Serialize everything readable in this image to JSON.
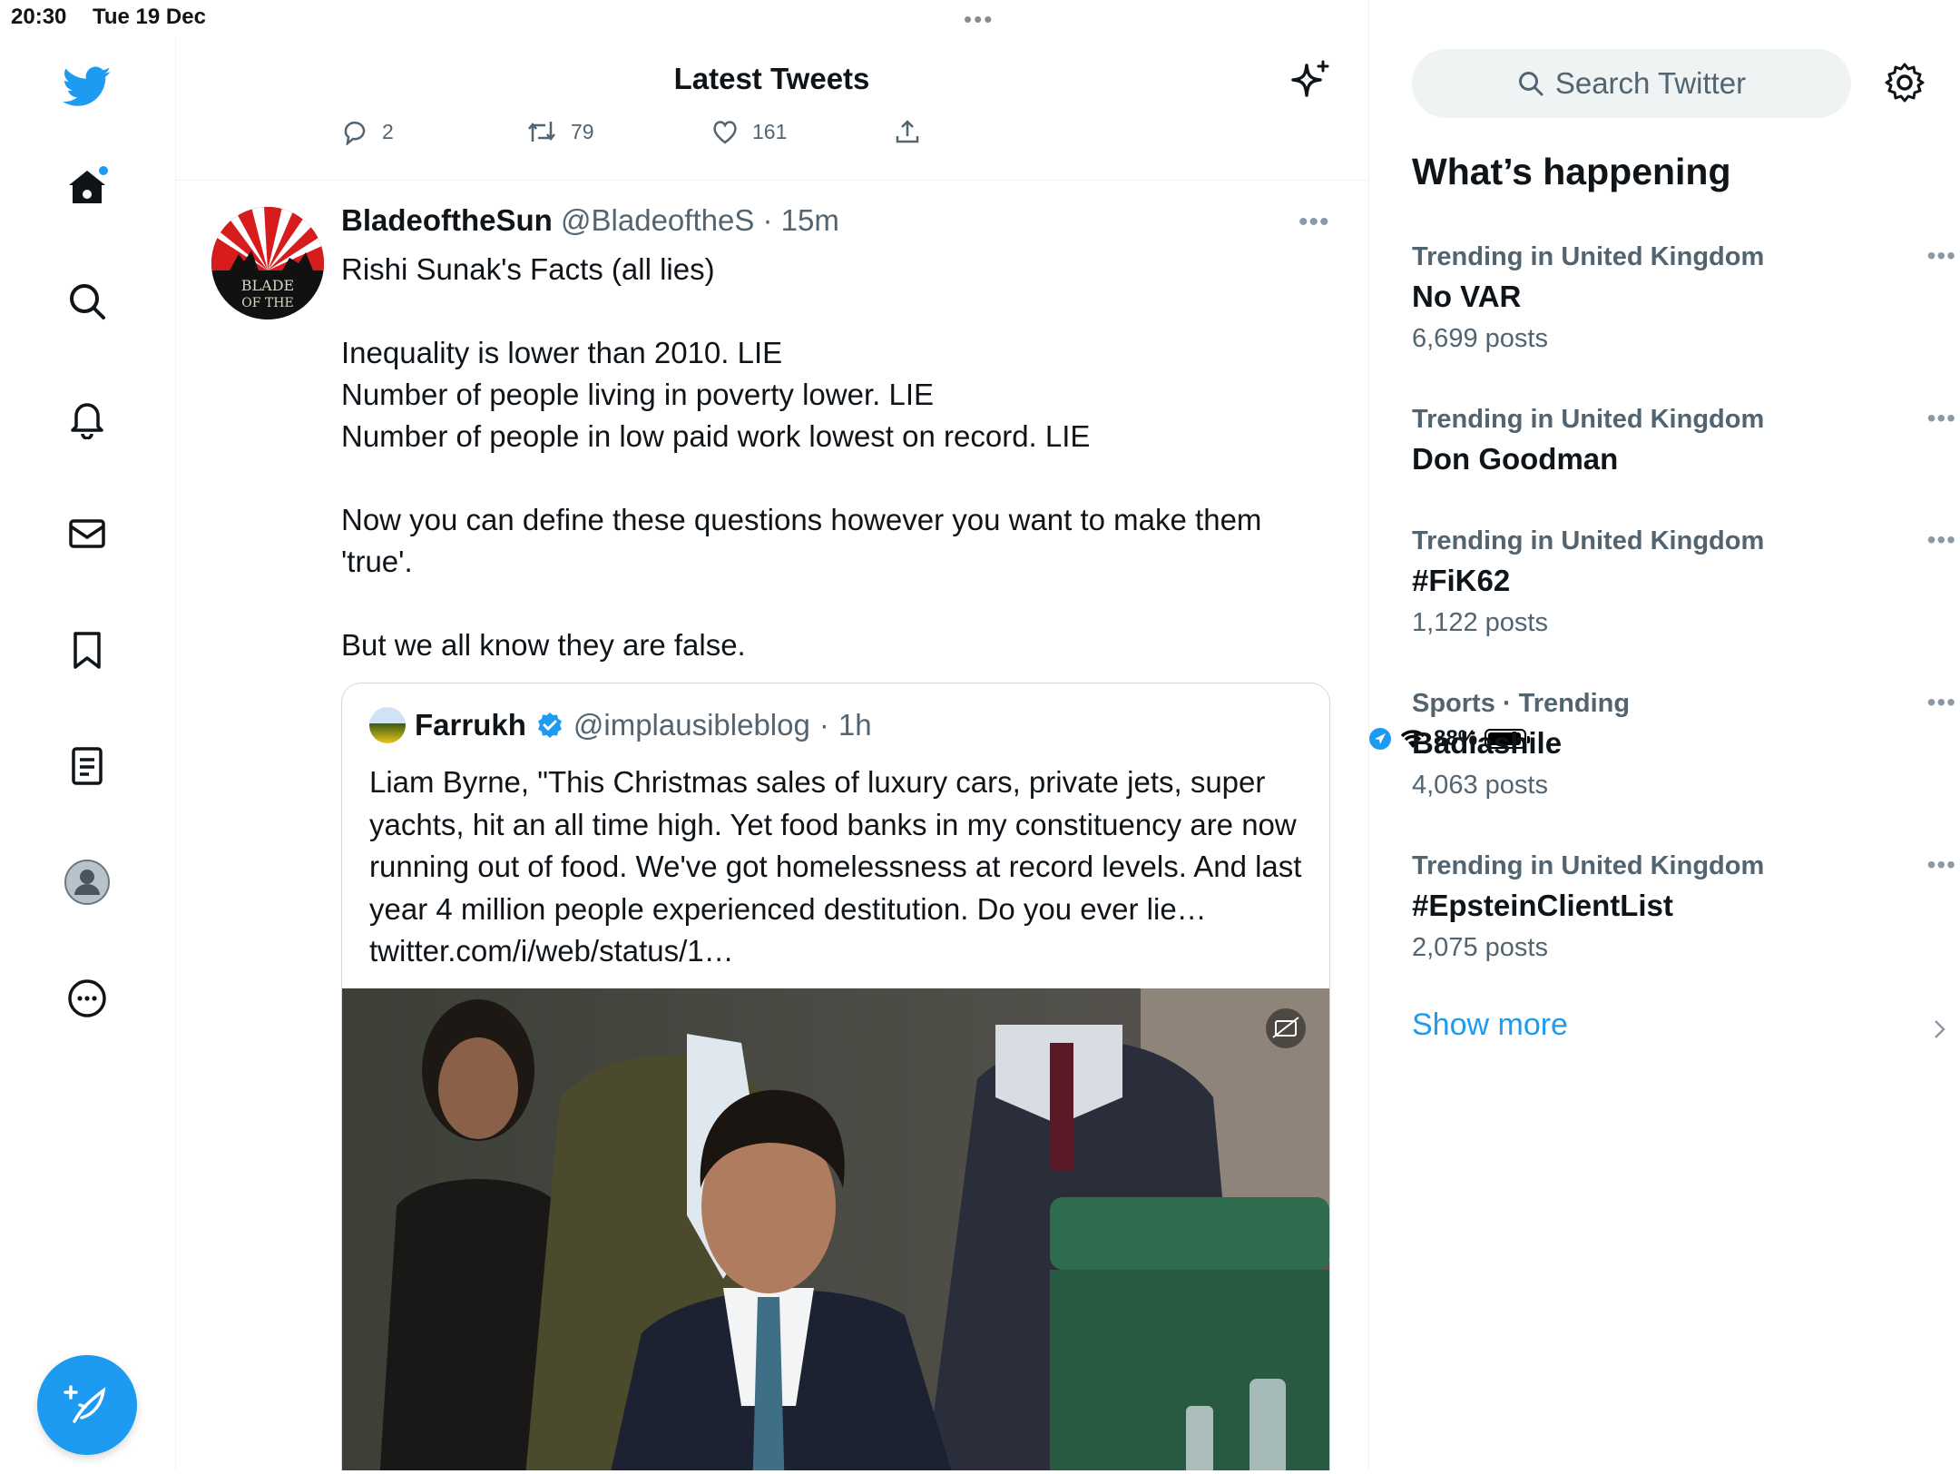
{
  "status_bar": {
    "time": "20:30",
    "date": "Tue 19 Dec",
    "battery": "88%"
  },
  "nav": {
    "items": [
      "twitter-logo",
      "home-icon",
      "search-icon",
      "bell-icon",
      "mail-icon",
      "bookmark-icon",
      "lists-icon",
      "profile-icon",
      "more-icon"
    ],
    "compose_icon": "compose-icon"
  },
  "header": {
    "title": "Latest Tweets"
  },
  "previous_tweet_actions": {
    "replies": "2",
    "retweets": "79",
    "likes": "161"
  },
  "tweet": {
    "display_name": "BladeoftheSun",
    "handle": "@BladeoftheS",
    "time": "15m",
    "avatar_text": "BLADE OF THE",
    "text": [
      "Rishi Sunak's Facts (all lies)",
      "Inequality is lower than 2010. LIE",
      "Number of people living in poverty lower. LIE",
      "Number of people in low paid work lowest on record. LIE",
      "Now you can define these questions however you want to make them 'true'.",
      "But we all know they are false."
    ],
    "quote": {
      "display_name": "Farrukh",
      "handle": "@implausibleblog",
      "time": "1h",
      "text": "Liam Byrne, \"This Christmas sales of luxury cars, private jets, super yachts, hit an all time high. Yet food banks in my constituency are now running out of food. We've got homelessness at record levels. And last year 4 million people experienced destitution. Do you ever lie… twitter.com/i/web/status/1…"
    }
  },
  "sidebar": {
    "search_placeholder": "Search Twitter",
    "whats_happening": "What’s happening",
    "trends": [
      {
        "context": "Trending in United Kingdom",
        "name": "No VAR",
        "count": "6,699 posts"
      },
      {
        "context": "Trending in United Kingdom",
        "name": "Don Goodman",
        "count": ""
      },
      {
        "context": "Trending in United Kingdom",
        "name": "#FiK62",
        "count": "1,122 posts"
      },
      {
        "context": "Sports · Trending",
        "name": "Badiashile",
        "count": "4,063 posts"
      },
      {
        "context": "Trending in United Kingdom",
        "name": "#EpsteinClientList",
        "count": "2,075 posts"
      }
    ],
    "show_more": "Show more"
  },
  "colors": {
    "accent": "#1d9bf0",
    "muted_text": "#536471",
    "border": "#eff3f4"
  }
}
